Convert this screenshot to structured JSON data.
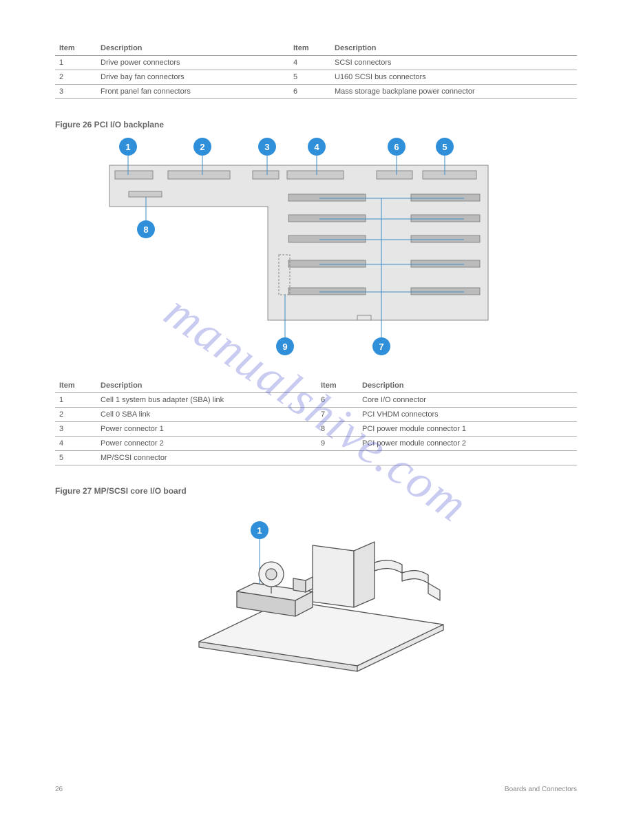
{
  "table25": {
    "headers": [
      "Item",
      "Description",
      "Item",
      "Description"
    ],
    "rows": [
      [
        "1",
        "Drive power connectors",
        "4",
        "SCSI connectors"
      ],
      [
        "2",
        "Drive bay fan connectors",
        "5",
        "U160 SCSI bus connectors"
      ],
      [
        "3",
        "Front panel fan connectors",
        "6",
        "Mass storage backplane power connector"
      ]
    ]
  },
  "fig26": {
    "title": "Figure 26 PCI I/O backplane",
    "callouts": [
      "1",
      "2",
      "3",
      "4",
      "6",
      "5",
      "8",
      "9",
      "7"
    ]
  },
  "table26": {
    "headers": [
      "Item",
      "Description",
      "Item",
      "Description"
    ],
    "rows": [
      [
        "1",
        "Cell 1 system bus adapter (SBA) link",
        "6",
        "Core I/O connector"
      ],
      [
        "2",
        "Cell 0 SBA link",
        "7",
        "PCI VHDM connectors"
      ],
      [
        "3",
        "Power connector 1",
        "8",
        "PCI power module connector 1"
      ],
      [
        "4",
        "Power connector 2",
        "9",
        "PCI power module connector 2"
      ],
      [
        "5",
        "MP/SCSI connector",
        "",
        ""
      ]
    ]
  },
  "fig27": {
    "title": "Figure 27 MP/SCSI core I/O board",
    "callouts": [
      "1"
    ]
  },
  "footer": {
    "page": "26",
    "section": "Boards and Connectors"
  }
}
